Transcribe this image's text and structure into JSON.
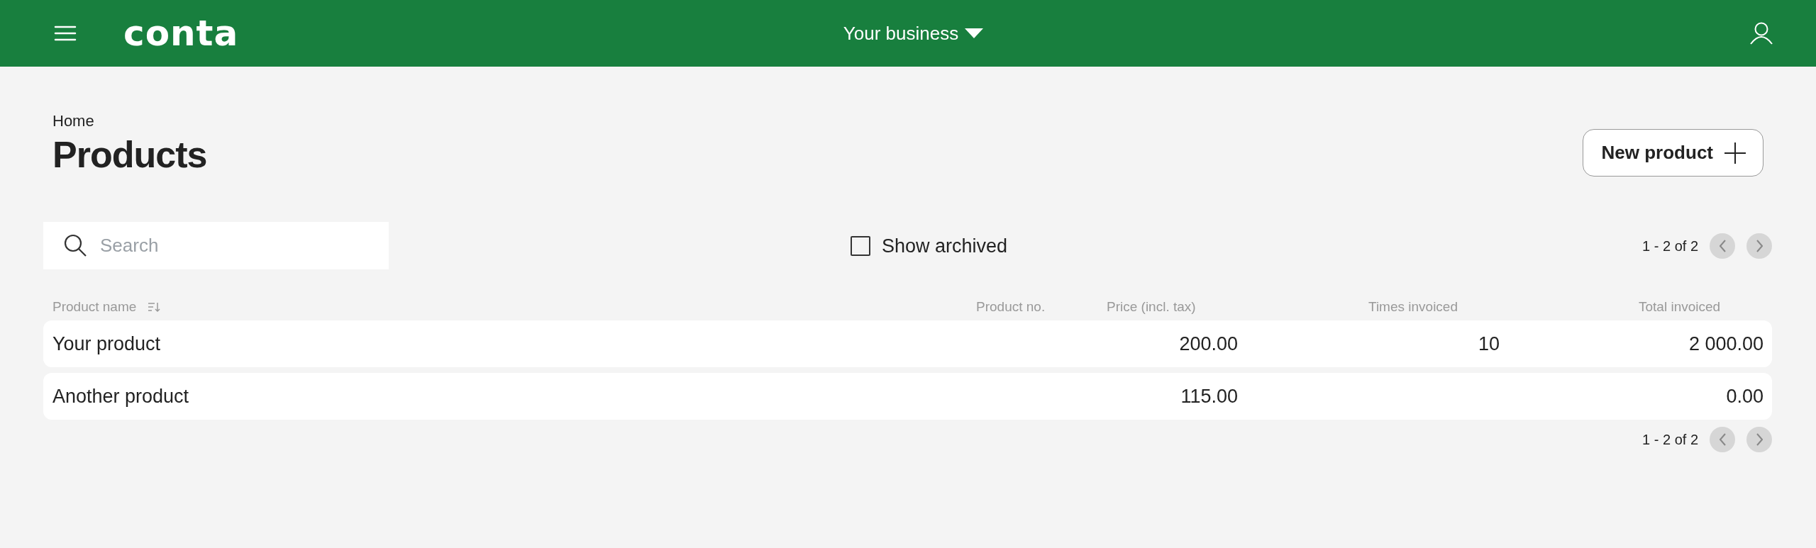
{
  "header": {
    "logo": "conta",
    "business": "Your business"
  },
  "breadcrumb": [
    "Home"
  ],
  "title": "Products",
  "new_button": "New product",
  "search": {
    "placeholder": "Search"
  },
  "show_archived": {
    "label": "Show archived",
    "checked": false
  },
  "pagination_top": "1 - 2 of 2",
  "table": {
    "columns": [
      "Product name",
      "Product no.",
      "Price (incl. tax)",
      "Times invoiced",
      "Total invoiced"
    ],
    "rows": [
      {
        "name": "Your product",
        "price": "200.00",
        "times_invoiced": "10",
        "total_invoiced": "2 000.00"
      },
      {
        "name": "Another product",
        "price": "115.00",
        "total_invoiced": "0.00"
      }
    ]
  },
  "pagination_bottom": "1 - 2 of 2"
}
